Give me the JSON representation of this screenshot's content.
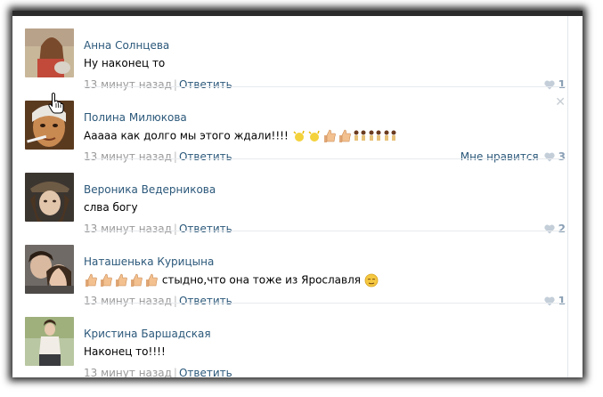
{
  "comments": [
    {
      "author": "Анна Солнцева",
      "text": "Ну наконец то",
      "time": "13 минут назад",
      "reply": "Ответить",
      "likes": "1",
      "like_label": ""
    },
    {
      "author": "Полина Милюкова",
      "text": "Ааааа как долго мы этого ждали!!!!",
      "time": "13 минут назад",
      "reply": "Ответить",
      "likes": "3",
      "like_label": "Мне нравится"
    },
    {
      "author": "Вероника Ведерникова",
      "text": "слва богу",
      "time": "13 минут назад",
      "reply": "Ответить",
      "likes": "2",
      "like_label": ""
    },
    {
      "author": "Наташенька Курицына",
      "text": "стыдно,что она тоже из Ярославля",
      "time": "13 минут назад",
      "reply": "Ответить",
      "likes": "1",
      "like_label": ""
    },
    {
      "author": "Кристина Баршадская",
      "text": "Наконец то!!!!",
      "time": "13 минут назад",
      "reply": "Ответить",
      "likes": "",
      "like_label": ""
    }
  ],
  "separator": "|",
  "colors": {
    "link": "#2b587a",
    "meta": "#999999",
    "like": "#8aa0b5"
  },
  "icons": {
    "like": "heart-icon",
    "delete": "close-icon",
    "cursor": "hand-pointer-icon",
    "emoji_thumbs": "thumbs-up-emoji",
    "emoji_stars": "sparkle-emoji",
    "emoji_people": "dancing-people-emoji",
    "emoji_face": "relieved-face-emoji"
  }
}
